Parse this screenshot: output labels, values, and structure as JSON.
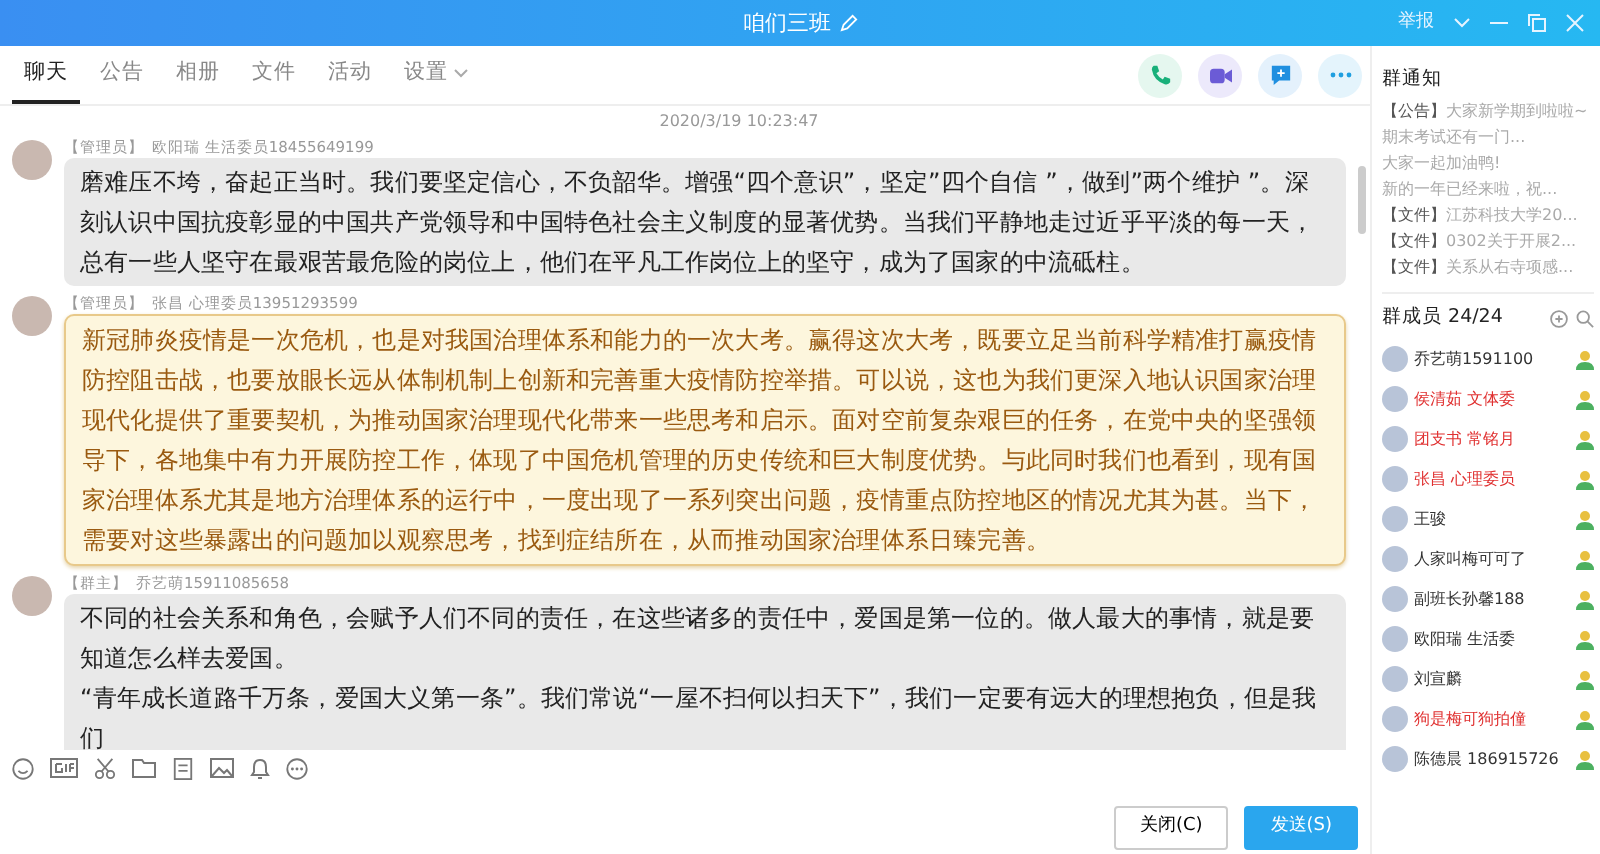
{
  "window": {
    "title": "咱们三班",
    "report": "举报"
  },
  "tabs": [
    {
      "label": "聊天",
      "selected": true
    },
    {
      "label": "公告",
      "selected": false
    },
    {
      "label": "相册",
      "selected": false
    },
    {
      "label": "文件",
      "selected": false
    },
    {
      "label": "活动",
      "selected": false
    },
    {
      "label": "设置",
      "selected": false,
      "dropdown": true
    }
  ],
  "chat": {
    "timestamp": "2020/3/19 10:23:47",
    "messages": [
      {
        "role": "【管理员】",
        "sender": "欧阳瑞 生活委员18455649199",
        "kind": "plain",
        "paragraphs": [
          "磨难压不垮，奋起正当时。我们要坚定信心，不负韶华。增强“四个意识”，坚定”四个自信 ”，做到”两个维护 ”。深刻认识中国抗疫彰显的中国共产党领导和中国特色社会主义制度的显著优势。当我们平静地走过近乎平淡的每一天，总有一些人坚守在最艰苦最危险的岗位上，他们在平凡工作岗位上的坚守，成为了国家的中流砥柱。"
        ]
      },
      {
        "role": "【管理员】",
        "sender": "张昌  心理委员13951293599",
        "kind": "highlight",
        "paragraphs": [
          "新冠肺炎疫情是一次危机，也是对我国治理体系和能力的一次大考。赢得这次大考，既要立足当前科学精准打赢疫情防控阻击战，也要放眼长远从体制机制上创新和完善重大疫情防控举措。可以说，这也为我们更深入地认识国家治理现代化提供了重要契机，为推动国家治理现代化带来一些思考和启示。面对空前复杂艰巨的任务，在党中央的坚强领导下，各地集中有力开展防控工作，体现了中国危机管理的历史传统和巨大制度优势。与此同时我们也看到，现有国家治理体系尤其是地方治理体系的运行中，一度出现了一系列突出问题，疫情重点防控地区的情况尤其为甚。当下，需要对这些暴露出的问题加以观察思考，找到症结所在，从而推动国家治理体系日臻完善。"
        ]
      },
      {
        "role": "【群主】",
        "sender": "乔艺萌15911085658",
        "kind": "plain",
        "paragraphs": [
          "不同的社会关系和角色，会赋予人们不同的责任，在这些诸多的责任中，爱国是第一位的。做人最大的事情，就是要知道怎么样去爱国。",
          "“青年成长道路千万条，爱国大义第一条”。我们常说“一屋不扫何以扫天下”，我们一定要有远大的理想抱负，但是我们"
        ]
      }
    ]
  },
  "composer": {
    "close_button": "关闭(C)",
    "send_button": "发送(S)"
  },
  "notices": {
    "title": "群通知",
    "items": [
      {
        "tag": "【公告】",
        "text": "大家新学期到啦啦~期末考试还有一门..."
      },
      {
        "text": "大家一起加油鸭!"
      },
      {
        "text": "新的一年已经来啦，祝..."
      },
      {
        "tag": "【文件】",
        "text": "江苏科技大学20..."
      },
      {
        "tag": "【文件】",
        "text": "0302关于开展2..."
      },
      {
        "tag": "【文件】",
        "text": "关系从右寺项感..."
      }
    ]
  },
  "members": {
    "title": "群成员 24/24",
    "items": [
      {
        "name": "乔艺萌1591100",
        "color": "#333333"
      },
      {
        "name": "侯清茹 文体委",
        "color": "#e03030"
      },
      {
        "name": "团支书 常铭月",
        "color": "#e03030"
      },
      {
        "name": "张昌  心理委员",
        "color": "#e03030"
      },
      {
        "name": "王骏",
        "color": "#333333"
      },
      {
        "name": "人家叫梅可可了",
        "color": "#333333"
      },
      {
        "name": "副班长孙馨188",
        "color": "#333333"
      },
      {
        "name": "欧阳瑞 生活委",
        "color": "#333333"
      },
      {
        "name": "刘宣麟",
        "color": "#333333"
      },
      {
        "name": "狗是梅可狗拍僮",
        "color": "#e03030"
      },
      {
        "name": "陈德晨 186915726",
        "color": "#333333"
      }
    ]
  }
}
